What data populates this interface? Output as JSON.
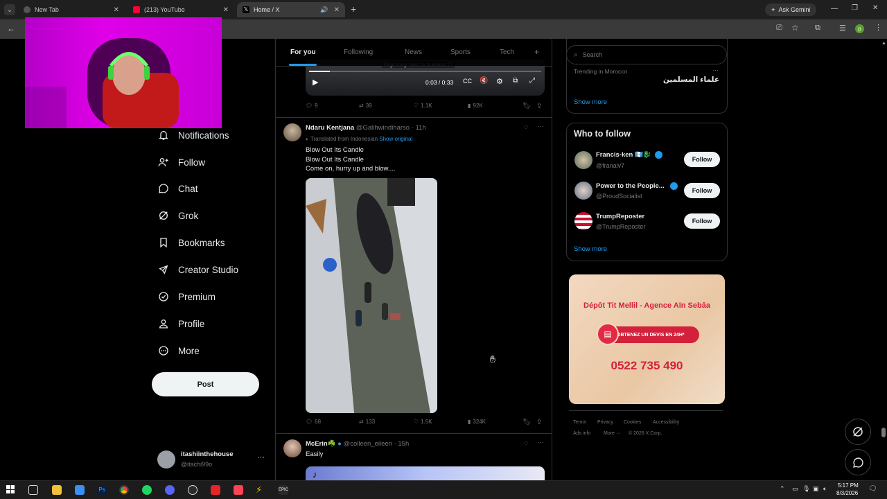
{
  "browser": {
    "tabs": [
      {
        "title": "New Tab"
      },
      {
        "title": "(213) YouTube"
      },
      {
        "title": "Home / X"
      }
    ],
    "ask_gemini": "Ask Gemini"
  },
  "nav": {
    "items": [
      {
        "label": "Notifications"
      },
      {
        "label": "Follow"
      },
      {
        "label": "Chat"
      },
      {
        "label": "Grok"
      },
      {
        "label": "Bookmarks"
      },
      {
        "label": "Creator Studio"
      },
      {
        "label": "Premium"
      },
      {
        "label": "Profile"
      },
      {
        "label": "More"
      }
    ],
    "post_label": "Post",
    "account": {
      "name": "itashiinthehouse",
      "handle": "@itachi99o"
    }
  },
  "feed": {
    "tabs": [
      "For you",
      "Following",
      "News",
      "Sports",
      "Tech"
    ],
    "video": {
      "caption": "Bajo muy bien la numero 11",
      "time": "0:03 / 0:33",
      "progress": 0.09
    },
    "post0_actions": {
      "replies": "9",
      "reposts": "39",
      "likes": "1.1K",
      "views": "92K"
    },
    "post1": {
      "name": "Ndaru Kentjana",
      "handle": "@Galihwindiharso",
      "time": "· 11h",
      "translated": "Translated from Indonesian",
      "show_original": "Show original",
      "lines": [
        "Blow Out Its Candle",
        "Blow Out Its Candle",
        "Come on, hurry up and blow...."
      ],
      "actions": {
        "replies": "68",
        "reposts": "133",
        "likes": "1.5K",
        "views": "324K"
      }
    },
    "post2": {
      "name": "McErin☘️",
      "handle": "@colleen_eileen",
      "time": "· 15h",
      "text": "Easily"
    }
  },
  "right": {
    "search_placeholder": "Search",
    "trending": {
      "context": "Trending in Morocco",
      "topic": "علماء المسلمين"
    },
    "show_more": "Show more",
    "who_title": "Who to follow",
    "follow_label": "Follow",
    "who": [
      {
        "name": "Francis-ken 🇬🇹🐉",
        "handle": "@franalv7"
      },
      {
        "name": "Power to the People...",
        "handle": "@ProudSocialist"
      },
      {
        "name": "TrumpReposter",
        "handle": "@TrumpReposter"
      }
    ],
    "ad": {
      "title": "Dépôt Tit Mellil - Agence Aïn Sebâa",
      "cta": "OBTENEZ UN DEVIS EN 24H*",
      "phone": "0522 735 490"
    },
    "footer": [
      "Terms",
      "Privacy",
      "Cookies",
      "Accessibility",
      "Ads info",
      "More ···",
      "© 2026 X Corp."
    ]
  },
  "system": {
    "time": "5:17 PM",
    "date": "8/3/2026"
  },
  "colors": {
    "accent": "#1d9bf0",
    "bg": "#000000",
    "border": "#2f3336",
    "muted": "#71767b"
  }
}
